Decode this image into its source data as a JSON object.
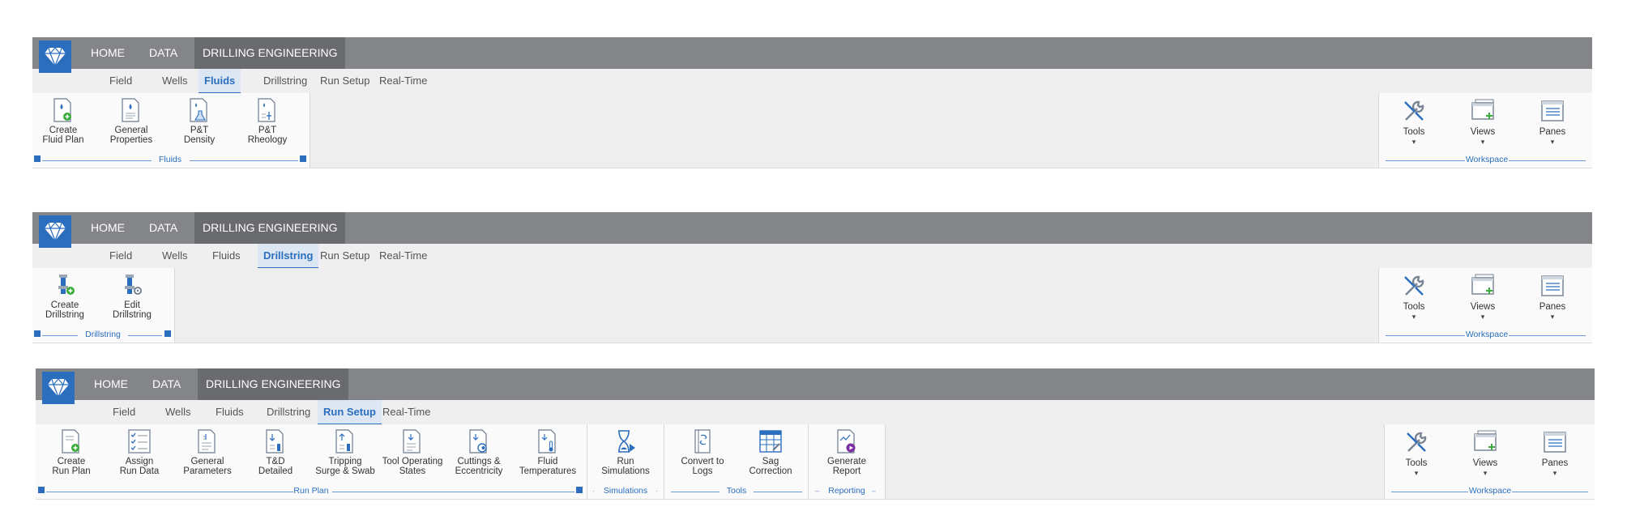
{
  "main_tabs": [
    "HOME",
    "DATA",
    "DRILLING ENGINEERING"
  ],
  "sub_tabs": [
    "Field",
    "Wells",
    "Fluids",
    "Drillstring",
    "Run Setup",
    "Real-Time"
  ],
  "ribbon1": {
    "active_subtab": "Fluids",
    "group_label": "Fluids",
    "buttons": [
      "Create\nFluid Plan",
      "General\nProperties",
      "P&T\nDensity",
      "P&T\nRheology"
    ]
  },
  "ribbon2": {
    "active_subtab": "Drillstring",
    "group_label": "Drillstring",
    "buttons": [
      "Create\nDrillstring",
      "Edit\nDrillstring"
    ]
  },
  "ribbon3": {
    "active_subtab": "Run Setup",
    "run_plan_label": "Run Plan",
    "run_plan_buttons": [
      "Create\nRun Plan",
      "Assign\nRun Data",
      "General\nParameters",
      "T&D\nDetailed",
      "Tripping\nSurge & Swab",
      "Tool Operating\nStates",
      "Cuttings &\nEccentricity",
      "Fluid\nTemperatures"
    ],
    "simulations_label": "Simulations",
    "simulations_button": "Run\nSimulations",
    "tools_label": "Tools",
    "tools_buttons": [
      "Convert to\nLogs",
      "Sag\nCorrection"
    ],
    "reporting_label": "Reporting",
    "reporting_button": "Generate\nReport"
  },
  "workspace": {
    "label": "Workspace",
    "buttons": [
      "Tools",
      "Views",
      "Panes"
    ],
    "caret": "▾"
  },
  "colors": {
    "accent": "#2a6ebd",
    "topbar": "#848589",
    "active_main": "#6a6b6f"
  }
}
